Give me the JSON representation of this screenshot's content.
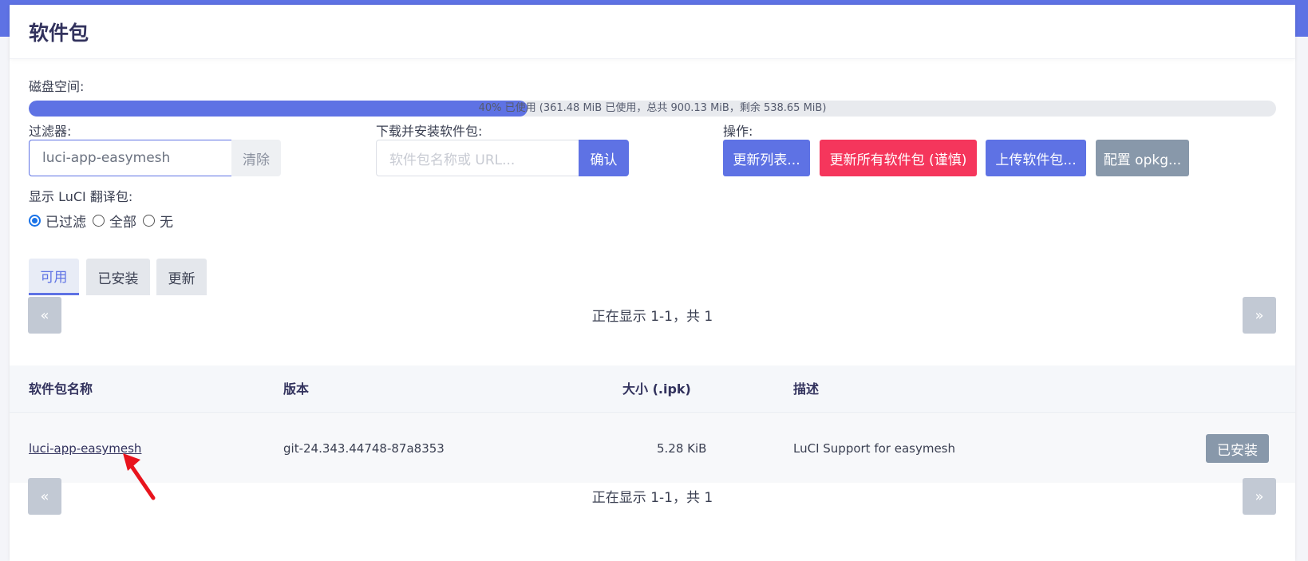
{
  "colors": {
    "accent": "#5e72e4",
    "danger": "#f5365c",
    "gray": "#8898aa",
    "red_arrow": "#e8141d"
  },
  "page": {
    "title": "软件包"
  },
  "disk": {
    "label": "磁盘空间:",
    "used_fraction": 0.4,
    "text": "40% 已使用 (361.48 MiB 已使用，总共 900.13 MiB，剩余 538.65 MiB)"
  },
  "filter": {
    "label": "过滤器:",
    "value": "luci-app-easymesh",
    "clear_label": "清除"
  },
  "download": {
    "label": "下载并安装软件包:",
    "placeholder": "软件包名称或 URL...",
    "confirm_label": "确认"
  },
  "actions": {
    "label": "操作:",
    "update_lists": "更新列表...",
    "upgrade_all": "更新所有软件包 (谨慎)",
    "upload": "上传软件包...",
    "configure": "配置 opkg..."
  },
  "translations": {
    "label": "显示 LuCI 翻译包:",
    "options": [
      "已过滤",
      "全部",
      "无"
    ],
    "selected": "已过滤"
  },
  "tabs": [
    "可用",
    "已安装",
    "更新"
  ],
  "active_tab": "可用",
  "pager": {
    "prev": "«",
    "next": "»",
    "text": "正在显示 1-1，共 1"
  },
  "table": {
    "headers": [
      "软件包名称",
      "版本",
      "大小 (.ipk)",
      "描述"
    ],
    "rows": [
      {
        "name": "luci-app-easymesh",
        "version": "git-24.343.44748-87a8353",
        "size": "5.28 KiB",
        "description": "LuCI Support for easymesh",
        "action": "已安装"
      }
    ]
  }
}
